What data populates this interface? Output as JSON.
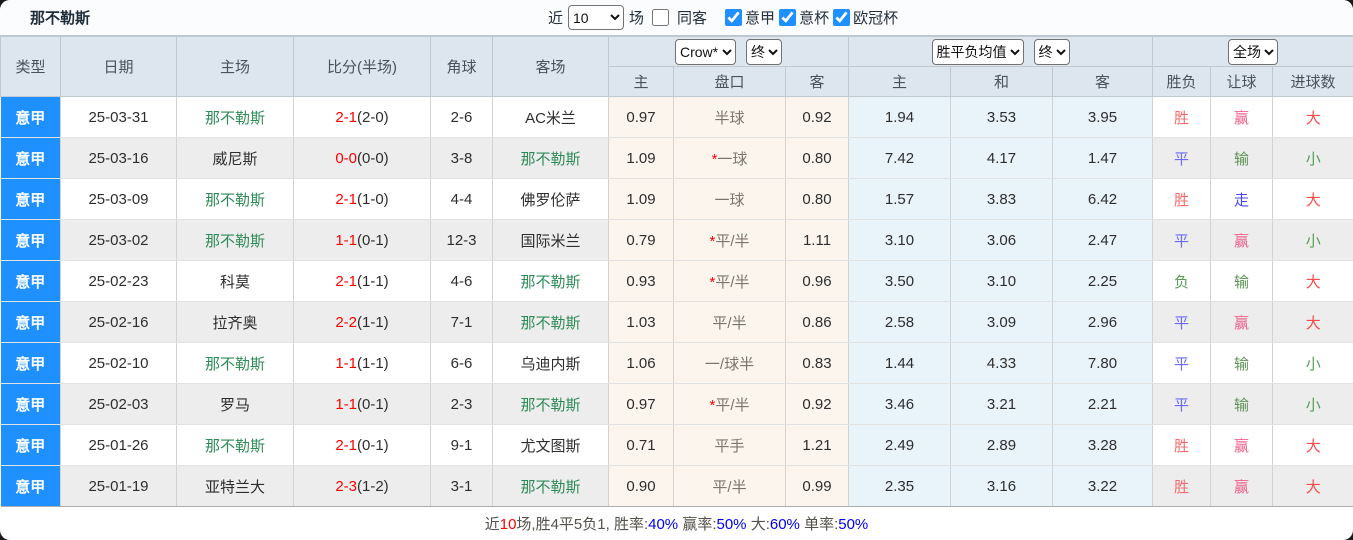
{
  "page": {
    "title": "那不勒斯"
  },
  "filters": {
    "recent_label": "近",
    "recent_count": "10",
    "matches_label": "场",
    "same_away_label": "同客",
    "same_away_checked": false,
    "leagues": [
      {
        "label": "意甲",
        "checked": true
      },
      {
        "label": "意杯",
        "checked": true
      },
      {
        "label": "欧冠杯",
        "checked": true
      }
    ]
  },
  "table": {
    "columns": {
      "type": "类型",
      "date": "日期",
      "home": "主场",
      "score": "比分(半场)",
      "corner": "角球",
      "away": "客场",
      "odds_sub": [
        "主",
        "盘口",
        "客"
      ],
      "avg_sub": [
        "主",
        "和",
        "客"
      ],
      "result_sub": [
        "胜负",
        "让球",
        "进球数"
      ]
    },
    "selects": {
      "bookmaker": "Crow*",
      "bookmaker_time": "终",
      "avg_label": "胜平负均值",
      "avg_time": "终",
      "scope": "全场"
    },
    "rows": [
      {
        "type": "意甲",
        "date": "25-03-31",
        "home": "那不勒斯",
        "score": "2-1",
        "half": "(2-0)",
        "corner": "2-6",
        "away": "AC米兰",
        "odds_home": "0.97",
        "handicap": "半球",
        "handicap_star": false,
        "odds_away": "0.92",
        "avg_win": "1.94",
        "avg_draw": "3.53",
        "avg_lose": "3.95",
        "result": "胜",
        "handicap_result": "赢",
        "goals": "大"
      },
      {
        "type": "意甲",
        "date": "25-03-16",
        "home": "威尼斯",
        "score": "0-0",
        "half": "(0-0)",
        "corner": "3-8",
        "away": "那不勒斯",
        "odds_home": "1.09",
        "handicap": "一球",
        "handicap_star": true,
        "odds_away": "0.80",
        "avg_win": "7.42",
        "avg_draw": "4.17",
        "avg_lose": "1.47",
        "result": "平",
        "handicap_result": "输",
        "goals": "小"
      },
      {
        "type": "意甲",
        "date": "25-03-09",
        "home": "那不勒斯",
        "score": "2-1",
        "half": "(1-0)",
        "corner": "4-4",
        "away": "佛罗伦萨",
        "odds_home": "1.09",
        "handicap": "一球",
        "handicap_star": false,
        "odds_away": "0.80",
        "avg_win": "1.57",
        "avg_draw": "3.83",
        "avg_lose": "6.42",
        "result": "胜",
        "handicap_result": "走",
        "goals": "大"
      },
      {
        "type": "意甲",
        "date": "25-03-02",
        "home": "那不勒斯",
        "score": "1-1",
        "half": "(0-1)",
        "corner": "12-3",
        "away": "国际米兰",
        "odds_home": "0.79",
        "handicap": "平/半",
        "handicap_star": true,
        "odds_away": "1.11",
        "avg_win": "3.10",
        "avg_draw": "3.06",
        "avg_lose": "2.47",
        "result": "平",
        "handicap_result": "赢",
        "goals": "小"
      },
      {
        "type": "意甲",
        "date": "25-02-23",
        "home": "科莫",
        "score": "2-1",
        "half": "(1-1)",
        "corner": "4-6",
        "away": "那不勒斯",
        "odds_home": "0.93",
        "handicap": "平/半",
        "handicap_star": true,
        "odds_away": "0.96",
        "avg_win": "3.50",
        "avg_draw": "3.10",
        "avg_lose": "2.25",
        "result": "负",
        "handicap_result": "输",
        "goals": "大"
      },
      {
        "type": "意甲",
        "date": "25-02-16",
        "home": "拉齐奥",
        "score": "2-2",
        "half": "(1-1)",
        "corner": "7-1",
        "away": "那不勒斯",
        "odds_home": "1.03",
        "handicap": "平/半",
        "handicap_star": false,
        "odds_away": "0.86",
        "avg_win": "2.58",
        "avg_draw": "3.09",
        "avg_lose": "2.96",
        "result": "平",
        "handicap_result": "赢",
        "goals": "大"
      },
      {
        "type": "意甲",
        "date": "25-02-10",
        "home": "那不勒斯",
        "score": "1-1",
        "half": "(1-1)",
        "corner": "6-6",
        "away": "乌迪内斯",
        "odds_home": "1.06",
        "handicap": "一/球半",
        "handicap_star": false,
        "odds_away": "0.83",
        "avg_win": "1.44",
        "avg_draw": "4.33",
        "avg_lose": "7.80",
        "result": "平",
        "handicap_result": "输",
        "goals": "小"
      },
      {
        "type": "意甲",
        "date": "25-02-03",
        "home": "罗马",
        "score": "1-1",
        "half": "(0-1)",
        "corner": "2-3",
        "away": "那不勒斯",
        "odds_home": "0.97",
        "handicap": "平/半",
        "handicap_star": true,
        "odds_away": "0.92",
        "avg_win": "3.46",
        "avg_draw": "3.21",
        "avg_lose": "2.21",
        "result": "平",
        "handicap_result": "输",
        "goals": "小"
      },
      {
        "type": "意甲",
        "date": "25-01-26",
        "home": "那不勒斯",
        "score": "2-1",
        "half": "(0-1)",
        "corner": "9-1",
        "away": "尤文图斯",
        "odds_home": "0.71",
        "handicap": "平手",
        "handicap_star": false,
        "odds_away": "1.21",
        "avg_win": "2.49",
        "avg_draw": "2.89",
        "avg_lose": "3.28",
        "result": "胜",
        "handicap_result": "赢",
        "goals": "大"
      },
      {
        "type": "意甲",
        "date": "25-01-19",
        "home": "亚特兰大",
        "score": "2-3",
        "half": "(1-2)",
        "corner": "3-1",
        "away": "那不勒斯",
        "odds_home": "0.90",
        "handicap": "平/半",
        "handicap_star": false,
        "odds_away": "0.99",
        "avg_win": "2.35",
        "avg_draw": "3.16",
        "avg_lose": "3.22",
        "result": "胜",
        "handicap_result": "赢",
        "goals": "大"
      }
    ]
  },
  "summary": {
    "parts": [
      {
        "text": "近",
        "c": "base"
      },
      {
        "text": "10",
        "c": "red"
      },
      {
        "text": "场,胜4平5负1, 胜率:",
        "c": "base"
      },
      {
        "text": "40%",
        "c": "blue"
      },
      {
        "text": " 赢率:",
        "c": "base"
      },
      {
        "text": "50%",
        "c": "blue"
      },
      {
        "text": " 大:",
        "c": "base"
      },
      {
        "text": "60%",
        "c": "blue"
      },
      {
        "text": " 单率:",
        "c": "base"
      },
      {
        "text": "50%",
        "c": "blue"
      }
    ]
  },
  "colors": {
    "league_cell_bg": "#1e90ff",
    "team_highlight": "#2e8b57",
    "score_red": "#fe0000",
    "star_red": "#fe0000",
    "result": {
      "胜": "#f56b6b",
      "平": "#6b6bf5",
      "负": "#55a055"
    },
    "handicap_result": {
      "赢": "#f0608a",
      "输": "#5d9355",
      "走": "#4646ff"
    },
    "goals": {
      "大": "#fa4b4b",
      "小": "#55a055"
    },
    "summary_red": "#fe0000",
    "summary_blue": "#0000ee"
  }
}
